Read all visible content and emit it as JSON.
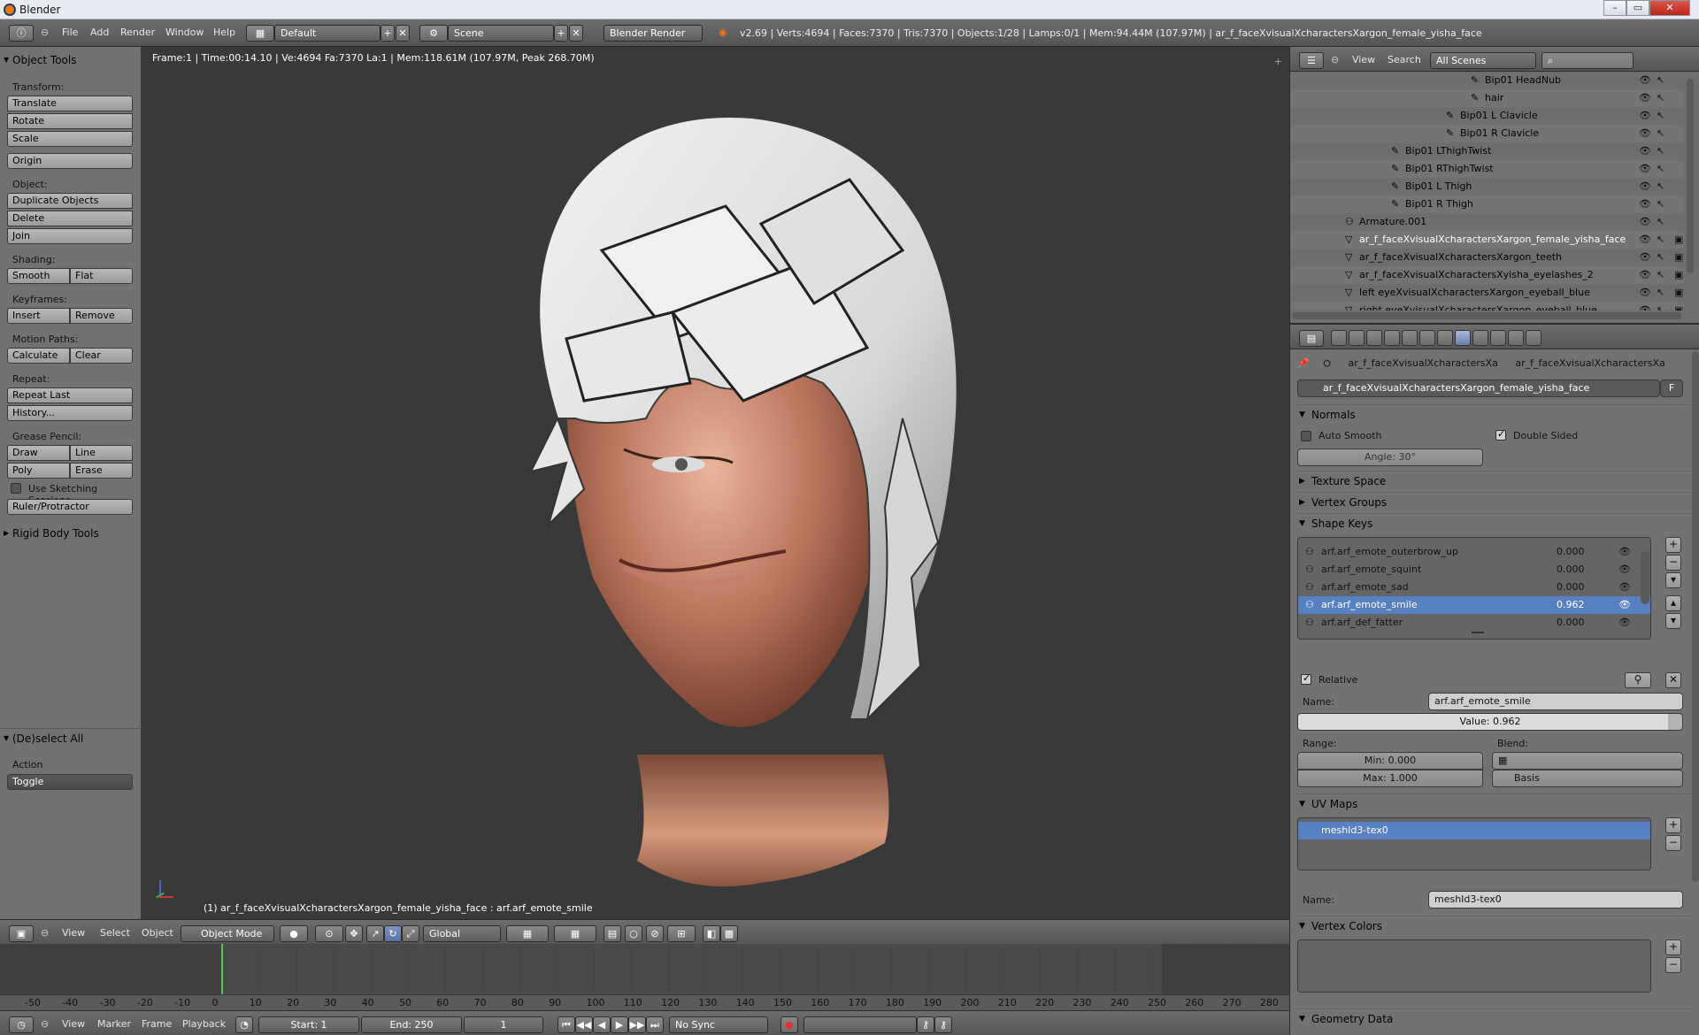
{
  "window": {
    "title": "Blender",
    "controls": [
      "–",
      "▭",
      "✕"
    ]
  },
  "info_header": {
    "menus": [
      "File",
      "Add",
      "Render",
      "Window",
      "Help"
    ],
    "layout": "Default",
    "scene": "Scene",
    "engine": "Blender Render",
    "stats": "v2.69 | Verts:4694 | Faces:7370 | Tris:7370 | Objects:1/28 | Lamps:0/1 | Mem:94.44M (107.97M) | ar_f_faceXvisualXcharactersXargon_female_yisha_face"
  },
  "toolshelf": {
    "title": "Object Tools",
    "transform_label": "Transform:",
    "transform": [
      "Translate",
      "Rotate",
      "Scale"
    ],
    "origin": "Origin",
    "object_label": "Object:",
    "object": [
      "Duplicate Objects",
      "Delete",
      "Join"
    ],
    "shading_label": "Shading:",
    "shading": [
      "Smooth",
      "Flat"
    ],
    "keyframes_label": "Keyframes:",
    "keyframes": [
      "Insert",
      "Remove"
    ],
    "motion_label": "Motion Paths:",
    "motion": [
      "Calculate",
      "Clear"
    ],
    "repeat_label": "Repeat:",
    "repeat": [
      "Repeat Last",
      "History..."
    ],
    "grease_label": "Grease Pencil:",
    "grease": [
      "Draw",
      "Line",
      "Poly",
      "Erase"
    ],
    "sketching": "Use Sketching Sessions",
    "ruler": "Ruler/Protractor",
    "rigid": "Rigid Body Tools",
    "deselect_title": "(De)select All",
    "action_label": "Action",
    "action_value": "Toggle"
  },
  "viewport": {
    "info": "Frame:1 | Time:00:14.10 | Ve:4694 Fa:7370 La:1 | Mem:118.61M (107.97M, Peak 268.70M)",
    "object_label": "(1) ar_f_faceXvisualXcharactersXargon_female_yisha_face : arf.arf_emote_smile"
  },
  "view3d_header": {
    "menus": [
      "View",
      "Select",
      "Object"
    ],
    "mode": "Object Mode",
    "orientation": "Global"
  },
  "timeline": {
    "ticks": [
      "-50",
      "-40",
      "-30",
      "-20",
      "-10",
      "0",
      "10",
      "20",
      "30",
      "40",
      "50",
      "60",
      "70",
      "80",
      "90",
      "100",
      "110",
      "120",
      "130",
      "140",
      "150",
      "160",
      "170",
      "180",
      "190",
      "200",
      "210",
      "220",
      "230",
      "240",
      "250",
      "260",
      "270",
      "280"
    ],
    "menus": [
      "View",
      "Marker",
      "Frame",
      "Playback"
    ],
    "start": "Start: 1",
    "end": "End: 250",
    "current": "1",
    "sync": "No Sync"
  },
  "outliner": {
    "menus": [
      "View",
      "Search"
    ],
    "filter": "All Scenes",
    "rows": [
      {
        "name": "Bip01 HeadNub"
      },
      {
        "name": "hair"
      },
      {
        "name": "Bip01 L Clavicle"
      },
      {
        "name": "Bip01 R Clavicle"
      },
      {
        "name": "Bip01 LThighTwist"
      },
      {
        "name": "Bip01 RThighTwist"
      },
      {
        "name": "Bip01 L Thigh"
      },
      {
        "name": "Bip01 R Thigh"
      },
      {
        "name": "Armature.001"
      },
      {
        "name": "ar_f_faceXvisualXcharactersXargon_female_yisha_face"
      },
      {
        "name": "ar_f_faceXvisualXcharactersXargon_teeth"
      },
      {
        "name": "ar_f_faceXvisualXcharactersXyisha_eyelashes_2"
      },
      {
        "name": "left eyeXvisualXcharactersXargon_eyeball_blue"
      },
      {
        "name": "right eyeXvisualXcharactersXargon_eyeball_blue"
      }
    ]
  },
  "properties": {
    "breadcrumb": [
      "ar_f_faceXvisualXcharactersXa",
      "ar_f_faceXvisualXcharactersXa"
    ],
    "mesh_name": "ar_f_faceXvisualXcharactersXargon_female_yisha_face",
    "fake_user": "F",
    "normals": {
      "title": "Normals",
      "auto_smooth": "Auto Smooth",
      "double_sided": "Double Sided",
      "angle": "Angle: 30°"
    },
    "texture_space": "Texture Space",
    "vertex_groups": "Vertex Groups",
    "shape_keys": {
      "title": "Shape Keys",
      "keys": [
        {
          "name": "arf.arf_emote_outerbrow_up",
          "value": "0.000"
        },
        {
          "name": "arf.arf_emote_squint",
          "value": "0.000"
        },
        {
          "name": "arf.arf_emote_sad",
          "value": "0.000"
        },
        {
          "name": "arf.arf_emote_smile",
          "value": "0.962"
        },
        {
          "name": "arf.arf_def_fatter",
          "value": "0.000"
        }
      ],
      "relative": "Relative",
      "name_label": "Name:",
      "name_value": "arf.arf_emote_smile",
      "value": "Value: 0.962",
      "value_fraction": 0.962,
      "range_label": "Range:",
      "min": "Min: 0.000",
      "max": "Max: 1.000",
      "blend_label": "Blend:",
      "blend_value": "Basis"
    },
    "uv_maps": {
      "title": "UV Maps",
      "item": "meshId3-tex0",
      "name_label": "Name:",
      "name_value": "meshId3-tex0"
    },
    "vertex_colors": "Vertex Colors",
    "geometry_data": "Geometry Data"
  }
}
